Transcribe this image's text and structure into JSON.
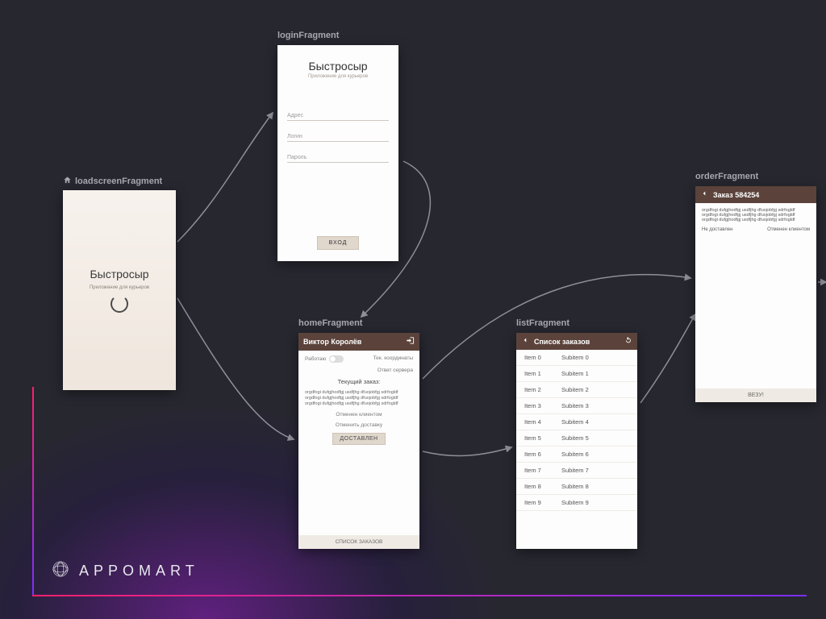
{
  "brand": {
    "name": "APPOMART"
  },
  "fragments": {
    "loadscreen": {
      "label": "loadscreenFragment",
      "title": "Быстросыр",
      "subtitle": "Приложение для курьеров"
    },
    "login": {
      "label": "loginFragment",
      "title": "Быстросыр",
      "subtitle": "Приложение для курьеров",
      "fields": {
        "address": "Адрес",
        "login": "Логин",
        "password": "Пароль"
      },
      "submit": "ВХОД"
    },
    "home": {
      "label": "homeFragment",
      "header": "Виктор Королёв",
      "works_label": "Работаю",
      "coords_label": "Тек. координаты",
      "server_label": "Ответ сервера",
      "current_order": "Текущий заказ:",
      "blurb": "orgdfogi dufgjhodfgj usdfjhg dfuojobfgj sdrfogldf orgdfogi dufgjhodfgj usdfjhg dfuojobfgj sdrfogldf orgdfogi dufgjhodfgj usdfjhg dfuojobfgj sdrfogldf",
      "cancelled_by_client": "Отменен клиентом",
      "cancel_delivery": "Отменить доставку",
      "delivered_btn": "ДОСТАВЛЕН",
      "footer": "СПИСОК ЗАКАЗОВ"
    },
    "list": {
      "label": "listFragment",
      "header": "Список заказов",
      "items": [
        {
          "k": "Item 0",
          "v": "Subitem 0"
        },
        {
          "k": "Item 1",
          "v": "Subitem 1"
        },
        {
          "k": "Item 2",
          "v": "Subitem 2"
        },
        {
          "k": "Item 3",
          "v": "Subitem 3"
        },
        {
          "k": "Item 4",
          "v": "Subitem 4"
        },
        {
          "k": "Item 5",
          "v": "Subitem 5"
        },
        {
          "k": "Item 6",
          "v": "Subitem 6"
        },
        {
          "k": "Item 7",
          "v": "Subitem 7"
        },
        {
          "k": "Item 8",
          "v": "Subitem 8"
        },
        {
          "k": "Item 9",
          "v": "Subitem 9"
        }
      ]
    },
    "order": {
      "label": "orderFragment",
      "header": "Заказ 584254",
      "blurb": "orgdfogi dufgjhodfgj usdfjhg dfuojobfgj sdrfogldf orgdfogi dufgjhodfgj usdfjhg dfuojobfgj sdrfogldf orgdfogi dufgjhodfgj usdfjhg dfuojobfgj sdrfogldf",
      "status_left": "Не доставлен",
      "status_right": "Отменен клиентом",
      "footer": "ВЕЗУ!"
    }
  },
  "nav_edges": [
    {
      "from": "loadscreenFragment",
      "to": "loginFragment"
    },
    {
      "from": "loadscreenFragment",
      "to": "homeFragment"
    },
    {
      "from": "loginFragment",
      "to": "homeFragment"
    },
    {
      "from": "homeFragment",
      "to": "listFragment"
    },
    {
      "from": "homeFragment",
      "to": "orderFragment"
    },
    {
      "from": "listFragment",
      "to": "orderFragment"
    },
    {
      "from": "orderFragment",
      "to": "(next)"
    }
  ]
}
